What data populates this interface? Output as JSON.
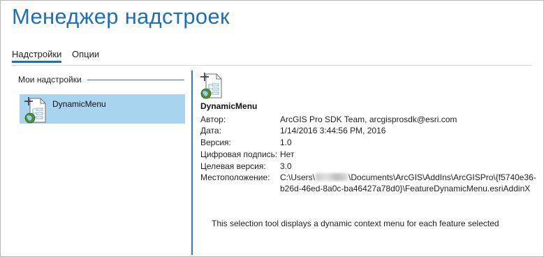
{
  "window": {
    "title": "Менеджер надстроек"
  },
  "tabs": [
    {
      "label": "Надстройки",
      "active": true
    },
    {
      "label": "Опции",
      "active": false
    }
  ],
  "sidebar": {
    "section_label": "Мои надстройки",
    "items": [
      {
        "label": "DynamicMenu",
        "icon": "addin-tool-icon",
        "selected": true
      }
    ]
  },
  "details": {
    "name": "DynamicMenu",
    "icon": "addin-tool-icon",
    "properties": [
      {
        "label": "Автор:",
        "value": "ArcGIS Pro SDK Team, arcgisprosdk@esri.com"
      },
      {
        "label": "Дата:",
        "value": "1/14/2016 3:44:56 PM, 2016"
      },
      {
        "label": "Версия:",
        "value": "1.0"
      },
      {
        "label": "Цифровая подпись:",
        "value": "Нет"
      },
      {
        "label": "Целевая версия:",
        "value": "3.0"
      },
      {
        "label": "Местоположение:",
        "value_prefix": "C:\\Users\\",
        "value_suffix": "\\Documents\\ArcGIS\\AddIns\\ArcGISPro\\{f5740e36-",
        "value_line2": "b26d-46ed-8a0c-ba46427a78d0}\\FeatureDynamicMenu.esriAddinX"
      }
    ],
    "description": "This selection tool displays a dynamic context menu for each feature selected"
  },
  "colors": {
    "accent": "#1e6fb8",
    "selection": "#a9d4f0",
    "splitter": "#2d7cc1"
  }
}
